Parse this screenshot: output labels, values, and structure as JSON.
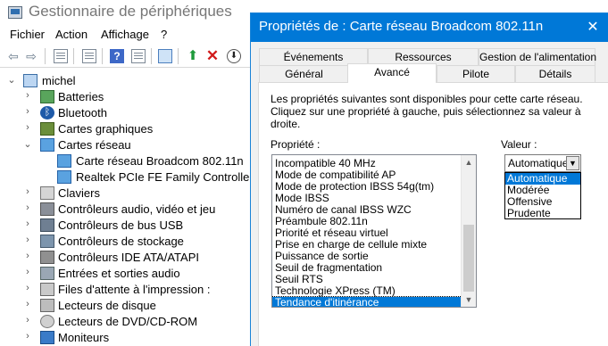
{
  "device_manager": {
    "title": "Gestionnaire de périphériques",
    "menu": [
      "Fichier",
      "Action",
      "Affichage",
      "?"
    ],
    "toolbar_icons": [
      "back-arrow-icon",
      "forward-arrow-icon",
      "properties-sheet-icon",
      "list-view-icon",
      "help-icon",
      "show-hidden-icon",
      "scan-monitor-icon",
      "enable-device-icon",
      "uninstall-device-icon",
      "update-driver-icon"
    ],
    "tree": {
      "root": "michel",
      "categories": [
        {
          "label": "Batteries",
          "icon": "battery-icon",
          "expanded": false
        },
        {
          "label": "Bluetooth",
          "icon": "bluetooth-icon",
          "expanded": false
        },
        {
          "label": "Cartes graphiques",
          "icon": "graphics-card-icon",
          "expanded": false
        },
        {
          "label": "Cartes réseau",
          "icon": "network-adapter-icon",
          "expanded": true,
          "children": [
            "Carte réseau Broadcom 802.11n",
            "Realtek PCIe FE Family Controller"
          ]
        },
        {
          "label": "Claviers",
          "icon": "keyboard-icon",
          "expanded": false
        },
        {
          "label": "Contrôleurs audio, vidéo et jeu",
          "icon": "sound-icon",
          "expanded": false
        },
        {
          "label": "Contrôleurs de bus USB",
          "icon": "usb-icon",
          "expanded": false
        },
        {
          "label": "Contrôleurs de stockage",
          "icon": "storage-icon",
          "expanded": false
        },
        {
          "label": "Contrôleurs IDE ATA/ATAPI",
          "icon": "ide-icon",
          "expanded": false
        },
        {
          "label": "Entrées et sorties audio",
          "icon": "audio-io-icon",
          "expanded": false
        },
        {
          "label": "Files d'attente à l'impression :",
          "icon": "printer-icon",
          "expanded": false
        },
        {
          "label": "Lecteurs de disque",
          "icon": "disk-drive-icon",
          "expanded": false
        },
        {
          "label": "Lecteurs de DVD/CD-ROM",
          "icon": "dvd-icon",
          "expanded": false
        },
        {
          "label": "Moniteurs",
          "icon": "monitor-icon",
          "expanded": false
        }
      ]
    }
  },
  "dialog": {
    "title": "Propriétés de : Carte réseau Broadcom 802.11n",
    "close_glyph": "✕",
    "tabs_row1": [
      "Événements",
      "Ressources",
      "Gestion de l'alimentation"
    ],
    "tabs_row2": [
      "Général",
      "Avancé",
      "Pilote",
      "Détails"
    ],
    "active_tab": "Avancé",
    "description": "Les propriétés suivantes sont disponibles pour cette carte réseau. Cliquez sur une propriété à gauche, puis sélectionnez sa valeur à droite.",
    "property_label": "Propriété :",
    "value_label": "Valeur :",
    "properties": [
      "Incompatible 40 MHz",
      "Mode de compatibilité AP",
      "Mode de protection IBSS 54g(tm)",
      "Mode IBSS",
      "Numéro de canal IBSS WZC",
      "Préambule 802.11n",
      "Priorité et réseau virtuel",
      "Prise en charge de cellule mixte",
      "Puissance de sortie",
      "Seuil de fragmentation",
      "Seuil RTS",
      "Technologie XPress (TM)",
      "Tendance d'itinérance"
    ],
    "selected_property": "Tendance d'itinérance",
    "value_selected": "Automatique",
    "value_options": [
      "Automatique",
      "Modérée",
      "Offensive",
      "Prudente"
    ],
    "accent_color": "#0078d7"
  }
}
